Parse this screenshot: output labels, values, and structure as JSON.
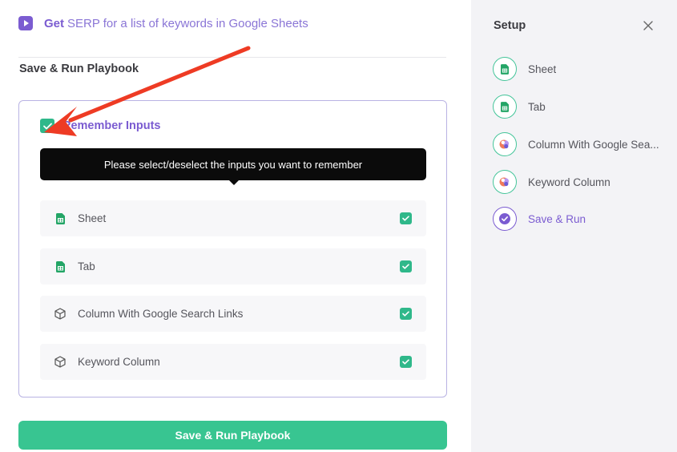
{
  "header": {
    "verb": "Get",
    "title_rest": "SERP for a list of keywords in Google Sheets",
    "icon": "play-icon",
    "accent": "#7b5cd1"
  },
  "section_title": "Save & Run Playbook",
  "remember": {
    "label": "Remember Inputs",
    "checked": true,
    "tooltip": "Please select/deselect the inputs you want to remember"
  },
  "inputs": [
    {
      "label": "Sheet",
      "icon": "google-sheets-icon",
      "checked": true
    },
    {
      "label": "Tab",
      "icon": "google-sheets-icon",
      "checked": true
    },
    {
      "label": "Column With Google Search Links",
      "icon": "cube-icon",
      "checked": true
    },
    {
      "label": "Keyword Column",
      "icon": "cube-icon",
      "checked": true
    }
  ],
  "run_button": {
    "label": "Save & Run Playbook",
    "color": "#38c591"
  },
  "sidebar": {
    "title": "Setup",
    "close_icon": "close-icon",
    "steps": [
      {
        "label": "Sheet",
        "icon": "google-sheets-icon",
        "active": false
      },
      {
        "label": "Tab",
        "icon": "google-sheets-icon",
        "active": false
      },
      {
        "label": "Column With Google Sea...",
        "icon": "bardeen-logo-icon",
        "active": false
      },
      {
        "label": "Keyword Column",
        "icon": "bardeen-logo-icon",
        "active": false
      },
      {
        "label": "Save & Run",
        "icon": "check-circle-icon",
        "active": true
      }
    ]
  }
}
